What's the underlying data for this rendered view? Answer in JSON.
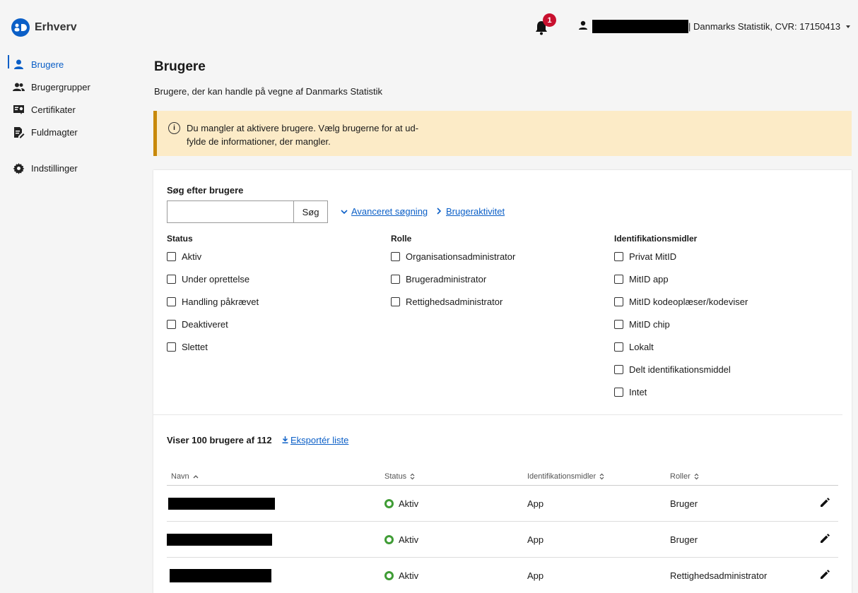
{
  "app": {
    "brand": "Erhverv"
  },
  "header": {
    "notification_count": "1",
    "org_label": "| Danmarks Statistik, CVR: 17150413"
  },
  "sidebar": {
    "items": [
      {
        "label": "Brugere",
        "icon": "person-icon",
        "active": true
      },
      {
        "label": "Brugergrupper",
        "icon": "group-icon"
      },
      {
        "label": "Certifikater",
        "icon": "certificate-icon"
      },
      {
        "label": "Fuldmagter",
        "icon": "document-edit-icon"
      },
      {
        "label": "Indstillinger",
        "icon": "gear-icon"
      }
    ]
  },
  "page": {
    "title": "Brugere",
    "subtitle": "Brugere, der kan handle på vegne af Danmarks Statistik"
  },
  "alert": {
    "text": "Du mangler at aktivere brugere. Vælg brugerne for at ud-fylde de informationer, der mangler."
  },
  "search": {
    "label": "Søg efter brugere",
    "value": "",
    "button": "Søg",
    "advanced_link": "Avanceret søgning",
    "activity_link": "Brugeraktivitet"
  },
  "filters": {
    "status": {
      "title": "Status",
      "options": [
        "Aktiv",
        "Under oprettelse",
        "Handling påkrævet",
        "Deaktiveret",
        "Slettet"
      ]
    },
    "rolle": {
      "title": "Rolle",
      "options": [
        "Organisationsadministrator",
        "Brugeradministrator",
        "Rettighedsadministrator"
      ]
    },
    "ident": {
      "title": "Identifikationsmidler",
      "options": [
        "Privat MitID",
        "MitID app",
        "MitID kodeoplæser/kodeviser",
        "MitID chip",
        "Lokalt",
        "Delt identifikationsmiddel",
        "Intet"
      ]
    }
  },
  "results": {
    "count_text": "Viser 100 brugere af 112",
    "export_link": "Eksportér liste"
  },
  "table": {
    "headers": {
      "name": "Navn",
      "status": "Status",
      "ident": "Identifikationsmidler",
      "roles": "Roller"
    },
    "rows": [
      {
        "status": "Aktiv",
        "ident": "App",
        "role": "Bruger"
      },
      {
        "status": "Aktiv",
        "ident": "App",
        "role": "Bruger"
      },
      {
        "status": "Aktiv",
        "ident": "App",
        "role": "Rettighedsadministrator"
      }
    ]
  },
  "colors": {
    "accent": "#0b5fc7",
    "alert_bg": "#fcebc7",
    "alert_border": "#c8890a",
    "status_active": "#3f9c35",
    "badge": "#c8102e"
  }
}
